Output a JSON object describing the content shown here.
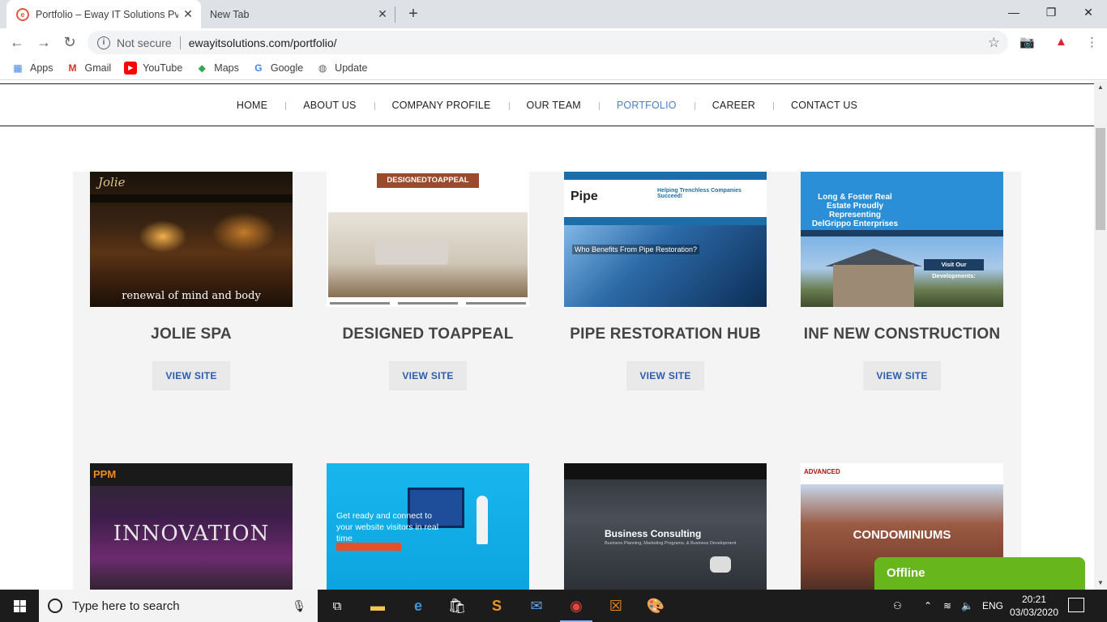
{
  "browser": {
    "tabs": [
      {
        "title": "Portfolio – Eway IT Solutions Pvt",
        "active": true
      },
      {
        "title": "New Tab",
        "active": false
      }
    ],
    "address": {
      "security": "Not secure",
      "url": "ewayitsolutions.com/portfolio/"
    },
    "bookmarks": [
      "Apps",
      "Gmail",
      "YouTube",
      "Maps",
      "Google",
      "Update"
    ]
  },
  "site": {
    "nav": [
      "HOME",
      "ABOUT US",
      "COMPANY PROFILE",
      "OUR TEAM",
      "PORTFOLIO",
      "CAREER",
      "CONTACT US"
    ],
    "active_nav": "PORTFOLIO",
    "cards": [
      {
        "title": "JOLIE SPA",
        "button": "VIEW SITE",
        "thumb_text": "renewal of mind and body",
        "thumb_logo": "Jolie"
      },
      {
        "title": "DESIGNED TOAPPEAL",
        "button": "VIEW SITE",
        "thumb_logo": "DESIGNEDTOAPPEAL"
      },
      {
        "title": "PIPE RESTORATION HUB",
        "button": "VIEW SITE",
        "thumb_logo": "Pipe",
        "thumb_text": "Who Benefits From Pipe Restoration?",
        "thumb_tag": "Helping Trenchless Companies Succeed!"
      },
      {
        "title": "INF NEW CONSTRUCTION",
        "button": "VIEW SITE",
        "thumb_text": "Long & Foster Real Estate Proudly Representing DelGrippo Enterprises",
        "thumb_tag": "Visit Our Developments:"
      },
      {
        "thumb_logo": "PPM",
        "thumb_text": "INNOVATION"
      },
      {
        "thumb_text": "Get ready and connect to your website visitors in real time"
      },
      {
        "thumb_text": "Business Consulting",
        "thumb_sub": "Business Planning, Marketing Programs, & Business Development"
      },
      {
        "thumb_logo": "ADVANCED",
        "thumb_text": "CONDOMINIUMS"
      }
    ],
    "chat_widget": "Offline"
  },
  "taskbar": {
    "search_placeholder": "Type here to search",
    "language": "ENG",
    "time": "20:21",
    "date": "03/03/2020"
  },
  "colors": {
    "nav_active": "#4a7fc1",
    "button_text": "#2a5db0",
    "offline_green": "#67b61c"
  }
}
